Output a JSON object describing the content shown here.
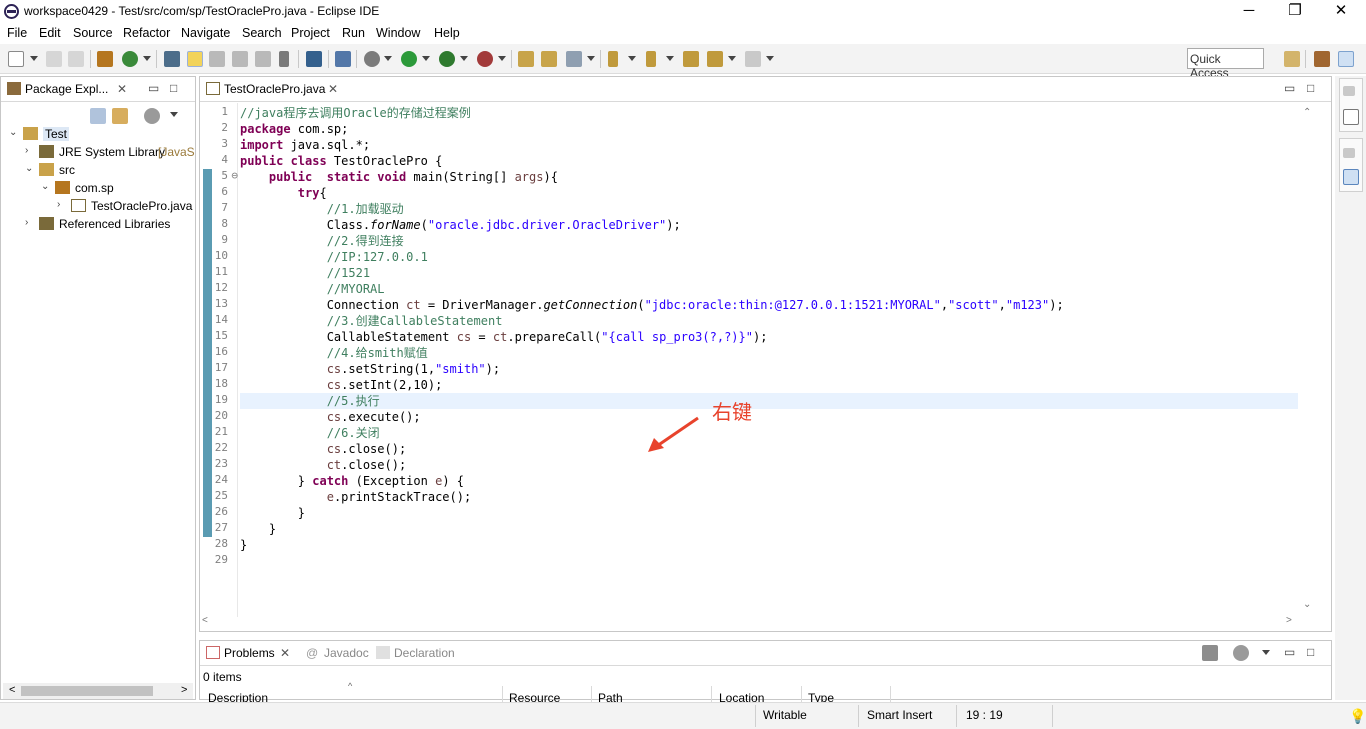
{
  "window": {
    "title": "workspace0429 - Test/src/com/sp/TestOraclePro.java - Eclipse IDE",
    "minimize": "─",
    "maximize": "❐",
    "close": "✕"
  },
  "menu": [
    "File",
    "Edit",
    "Source",
    "Refactor",
    "Navigate",
    "Search",
    "Project",
    "Run",
    "Window",
    "Help"
  ],
  "toolbar": {
    "quick_access": "Quick Access"
  },
  "package_explorer": {
    "tab_label": "Package Expl...",
    "tree": [
      {
        "label": "Test",
        "level": 0,
        "expanded": true,
        "selected": true,
        "icon": "project-icon"
      },
      {
        "label": "JRE System Library",
        "suffix": "[JavaS",
        "level": 1,
        "expanded": false,
        "icon": "library-icon"
      },
      {
        "label": "src",
        "level": 1,
        "expanded": true,
        "icon": "source-folder-icon"
      },
      {
        "label": "com.sp",
        "level": 2,
        "expanded": true,
        "icon": "package-icon"
      },
      {
        "label": "TestOraclePro.java",
        "level": 3,
        "expanded": false,
        "icon": "java-file-icon"
      },
      {
        "label": "Referenced Libraries",
        "level": 1,
        "expanded": false,
        "icon": "library-icon"
      }
    ]
  },
  "editor": {
    "tab_label": "TestOraclePro.java",
    "current_line": 19,
    "lines": [
      [
        {
          "t": "//java程序去调用Oracle的存储过程案例",
          "c": "cm"
        }
      ],
      [
        {
          "t": "package",
          "c": "kw"
        },
        {
          "t": " com.sp;"
        }
      ],
      [
        {
          "t": "import",
          "c": "kw"
        },
        {
          "t": " java.sql.*;"
        }
      ],
      [
        {
          "t": "public class",
          "c": "kw"
        },
        {
          "t": " TestOraclePro {"
        }
      ],
      [
        {
          "t": "    "
        },
        {
          "t": "public",
          "c": "kw"
        },
        {
          "t": "  "
        },
        {
          "t": "static void",
          "c": "kw"
        },
        {
          "t": " main(String[] "
        },
        {
          "t": "args",
          "c": "var"
        },
        {
          "t": "){"
        }
      ],
      [
        {
          "t": "        "
        },
        {
          "t": "try",
          "c": "kw"
        },
        {
          "t": "{"
        }
      ],
      [
        {
          "t": "            "
        },
        {
          "t": "//1.加载驱动",
          "c": "cm"
        }
      ],
      [
        {
          "t": "            Class."
        },
        {
          "t": "forName",
          "c": "it"
        },
        {
          "t": "("
        },
        {
          "t": "\"oracle.jdbc.driver.OracleDriver\"",
          "c": "st"
        },
        {
          "t": ");"
        }
      ],
      [
        {
          "t": "            "
        },
        {
          "t": "//2.得到连接",
          "c": "cm"
        }
      ],
      [
        {
          "t": "            "
        },
        {
          "t": "//IP:127.0.0.1",
          "c": "cm"
        }
      ],
      [
        {
          "t": "            "
        },
        {
          "t": "//1521",
          "c": "cm"
        }
      ],
      [
        {
          "t": "            "
        },
        {
          "t": "//MYORAL",
          "c": "cm"
        }
      ],
      [
        {
          "t": "            Connection "
        },
        {
          "t": "ct",
          "c": "var"
        },
        {
          "t": " = DriverManager."
        },
        {
          "t": "getConnection",
          "c": "it"
        },
        {
          "t": "("
        },
        {
          "t": "\"jdbc:oracle:thin:@127.0.0.1:1521:MYORAL\"",
          "c": "st"
        },
        {
          "t": ","
        },
        {
          "t": "\"scott\"",
          "c": "st"
        },
        {
          "t": ","
        },
        {
          "t": "\"m123\"",
          "c": "st"
        },
        {
          "t": ");"
        }
      ],
      [
        {
          "t": "            "
        },
        {
          "t": "//3.创建CallableStatement",
          "c": "cm"
        }
      ],
      [
        {
          "t": "            CallableStatement "
        },
        {
          "t": "cs",
          "c": "var"
        },
        {
          "t": " = "
        },
        {
          "t": "ct",
          "c": "var"
        },
        {
          "t": ".prepareCall("
        },
        {
          "t": "\"{call sp_pro3(?,?)}\"",
          "c": "st"
        },
        {
          "t": ");"
        }
      ],
      [
        {
          "t": "            "
        },
        {
          "t": "//4.给smith赋值",
          "c": "cm"
        }
      ],
      [
        {
          "t": "            "
        },
        {
          "t": "cs",
          "c": "var"
        },
        {
          "t": ".setString(1,"
        },
        {
          "t": "\"smith\"",
          "c": "st"
        },
        {
          "t": ");"
        }
      ],
      [
        {
          "t": "            "
        },
        {
          "t": "cs",
          "c": "var"
        },
        {
          "t": ".setInt(2,10);"
        }
      ],
      [
        {
          "t": "            "
        },
        {
          "t": "//5.执行",
          "c": "cm"
        }
      ],
      [
        {
          "t": "            "
        },
        {
          "t": "cs",
          "c": "var"
        },
        {
          "t": ".execute();"
        }
      ],
      [
        {
          "t": "            "
        },
        {
          "t": "//6.关闭",
          "c": "cm"
        }
      ],
      [
        {
          "t": "            "
        },
        {
          "t": "cs",
          "c": "var"
        },
        {
          "t": ".close();"
        }
      ],
      [
        {
          "t": "            "
        },
        {
          "t": "ct",
          "c": "var"
        },
        {
          "t": ".close();"
        }
      ],
      [
        {
          "t": "        } "
        },
        {
          "t": "catch",
          "c": "kw"
        },
        {
          "t": " (Exception "
        },
        {
          "t": "e",
          "c": "var"
        },
        {
          "t": ") {"
        }
      ],
      [
        {
          "t": "            "
        },
        {
          "t": "e",
          "c": "var"
        },
        {
          "t": ".printStackTrace();"
        }
      ],
      [
        {
          "t": "        }"
        }
      ],
      [
        {
          "t": "    }"
        }
      ],
      [
        {
          "t": "}"
        }
      ],
      []
    ]
  },
  "bottom_panel": {
    "tabs": [
      {
        "label": "Problems",
        "active": true
      },
      {
        "label": "Javadoc",
        "active": false
      },
      {
        "label": "Declaration",
        "active": false
      }
    ],
    "items_count": "0 items",
    "columns": [
      "Description",
      "Resource",
      "Path",
      "Location",
      "Type"
    ]
  },
  "status": {
    "writable": "Writable",
    "insert_mode": "Smart Insert",
    "position": "19 : 19"
  },
  "annotation": {
    "text": "右键",
    "color": "#e8432c"
  }
}
